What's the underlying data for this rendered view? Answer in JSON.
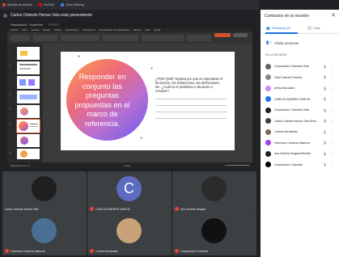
{
  "browser_tabs": [
    {
      "label": "Bandeja de entrada",
      "color": "#ea4335"
    },
    {
      "label": "YouTube",
      "color": "#ff0000"
    },
    {
      "label": "Zoom Meeting",
      "color": "#4285f4"
    }
  ],
  "meeting": {
    "title": "Carlos Orlando Henao Vela está presentando"
  },
  "ppt": {
    "window_title": "Presentación1 - PowerPoint",
    "menu": [
      "Archivo",
      "Inicio",
      "Insertar",
      "Dibujar",
      "Diseño",
      "Transiciones",
      "Animaciones",
      "Presentación con diapositivas",
      "Revisar",
      "Vista",
      "Ayuda"
    ],
    "accent": "#d35230",
    "thumb_numbers": [
      "1",
      "2",
      "3",
      "4",
      "5",
      "6",
      "7",
      "8"
    ],
    "slide": {
      "circle_text": "Responder en conjunto las preguntas propuestas en el marco de referencia.",
      "bullet": "¿POR QUÉ? Explica por qué es importante el fenómeno, las limitaciones, las definiciones, etc. ¿Cuál es el problema o situación a resolver?"
    },
    "status": {
      "left": "Diapositiva 6 de 14",
      "right": "Notas"
    }
  },
  "panel": {
    "title": "Contactos en la reunión",
    "close_glyph": "✕",
    "tab_people": "Personas (9)",
    "tab_chat": "Chat",
    "add_people": "Añadir personas",
    "section_label": "EN LA REUNIÓN",
    "participants": [
      {
        "name": "Corporación Colombia Vida",
        "color": "#5f6368"
      },
      {
        "name": "Gold Cafeína Ferreira",
        "color": "#8a8a8a"
      },
      {
        "name": "jenny educación",
        "color": "#c58af9"
      },
      {
        "name": "CARLOS ANDRÉS GARCÍA",
        "color": "#1a73e8"
      },
      {
        "name": "Corporación Colombia Vida",
        "color": "#202124"
      },
      {
        "name": "Carlos Orlando Henao Vela (Presentando)",
        "color": "#3c4043"
      },
      {
        "name": "Lorena Hernández",
        "color": "#7b6a5a"
      },
      {
        "name": "Francisco Cardona Valencia",
        "color": "#a142f4"
      },
      {
        "name": "Ana Victoria Vergara Rendón",
        "color": "#202124"
      },
      {
        "name": "Corporación Colombia",
        "color": "#000000"
      }
    ],
    "mic_glyph": "🎙",
    "more_glyph": "⋮"
  },
  "tiles": [
    {
      "name": "Carlos Orlando Henao Vela",
      "color": "#1f1f1f",
      "letter": "",
      "muted": false
    },
    {
      "name": "CARLOS ANDRÉS GARCÍA",
      "color": "#5c6bc0",
      "letter": "C",
      "muted": true
    },
    {
      "name": "Ana Victoria Vergara",
      "color": "#2b2b2b",
      "letter": "",
      "muted": true
    },
    {
      "name": "Francisco Cardona Valencia",
      "color": "#4a6f94",
      "letter": "",
      "muted": true
    },
    {
      "name": "Lorena Hernández",
      "color": "#c9a27a",
      "letter": "",
      "muted": true
    },
    {
      "name": "Corporación Colombia",
      "color": "#111111",
      "letter": "",
      "muted": true
    }
  ]
}
